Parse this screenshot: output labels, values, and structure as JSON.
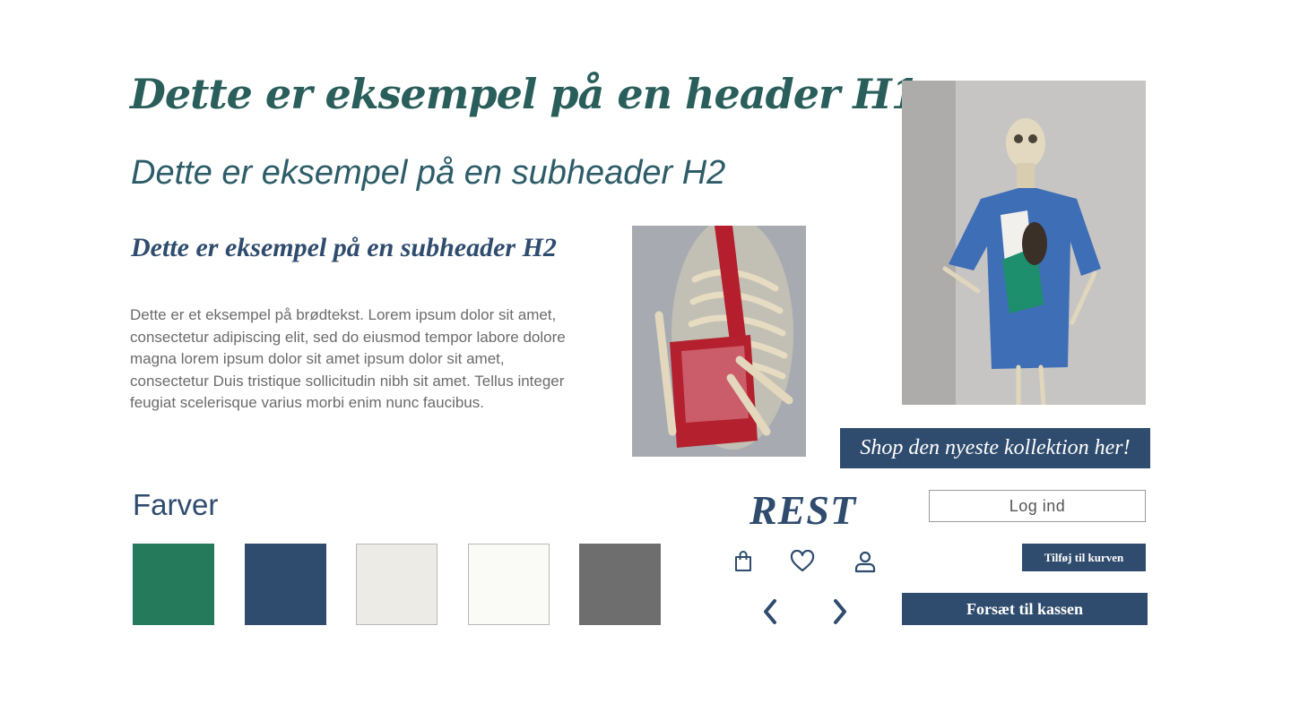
{
  "headers": {
    "h1": "Dette er eksempel på en header H1",
    "h2_sans": "Dette er eksempel på en subheader H2",
    "h2_serif": "Dette er eksempel på en subheader H2"
  },
  "body_text": "Dette er et eksempel på brødtekst. Lorem ipsum dolor sit amet, consectetur adipiscing elit, sed do eiusmod tempor labore dolore magna lorem ipsum dolor sit amet ipsum dolor sit amet, consectetur Duis tristique sollicitudin nibh sit amet. Tellus integer feugiat scelerisque varius morbi enim nunc faucibus.",
  "shop_banner": "Shop den nyeste kollektion her!",
  "colors": {
    "title": "Farver",
    "swatches": [
      "#257a5c",
      "#2f4c6e",
      "#ecebe5",
      "#fafaf7",
      "#6e6e6e"
    ]
  },
  "ui_kit": {
    "logo": "REST",
    "login_label": "Log ind",
    "add_to_cart_label": "Tilføj til kurven",
    "checkout_label": "Forsæt til kassen",
    "icons": [
      "shopping-bag-icon",
      "heart-icon",
      "user-icon",
      "chevron-left-icon",
      "chevron-right-icon"
    ]
  },
  "theme": {
    "primary": "#2f4c6e",
    "green": "#2a5e5a"
  }
}
